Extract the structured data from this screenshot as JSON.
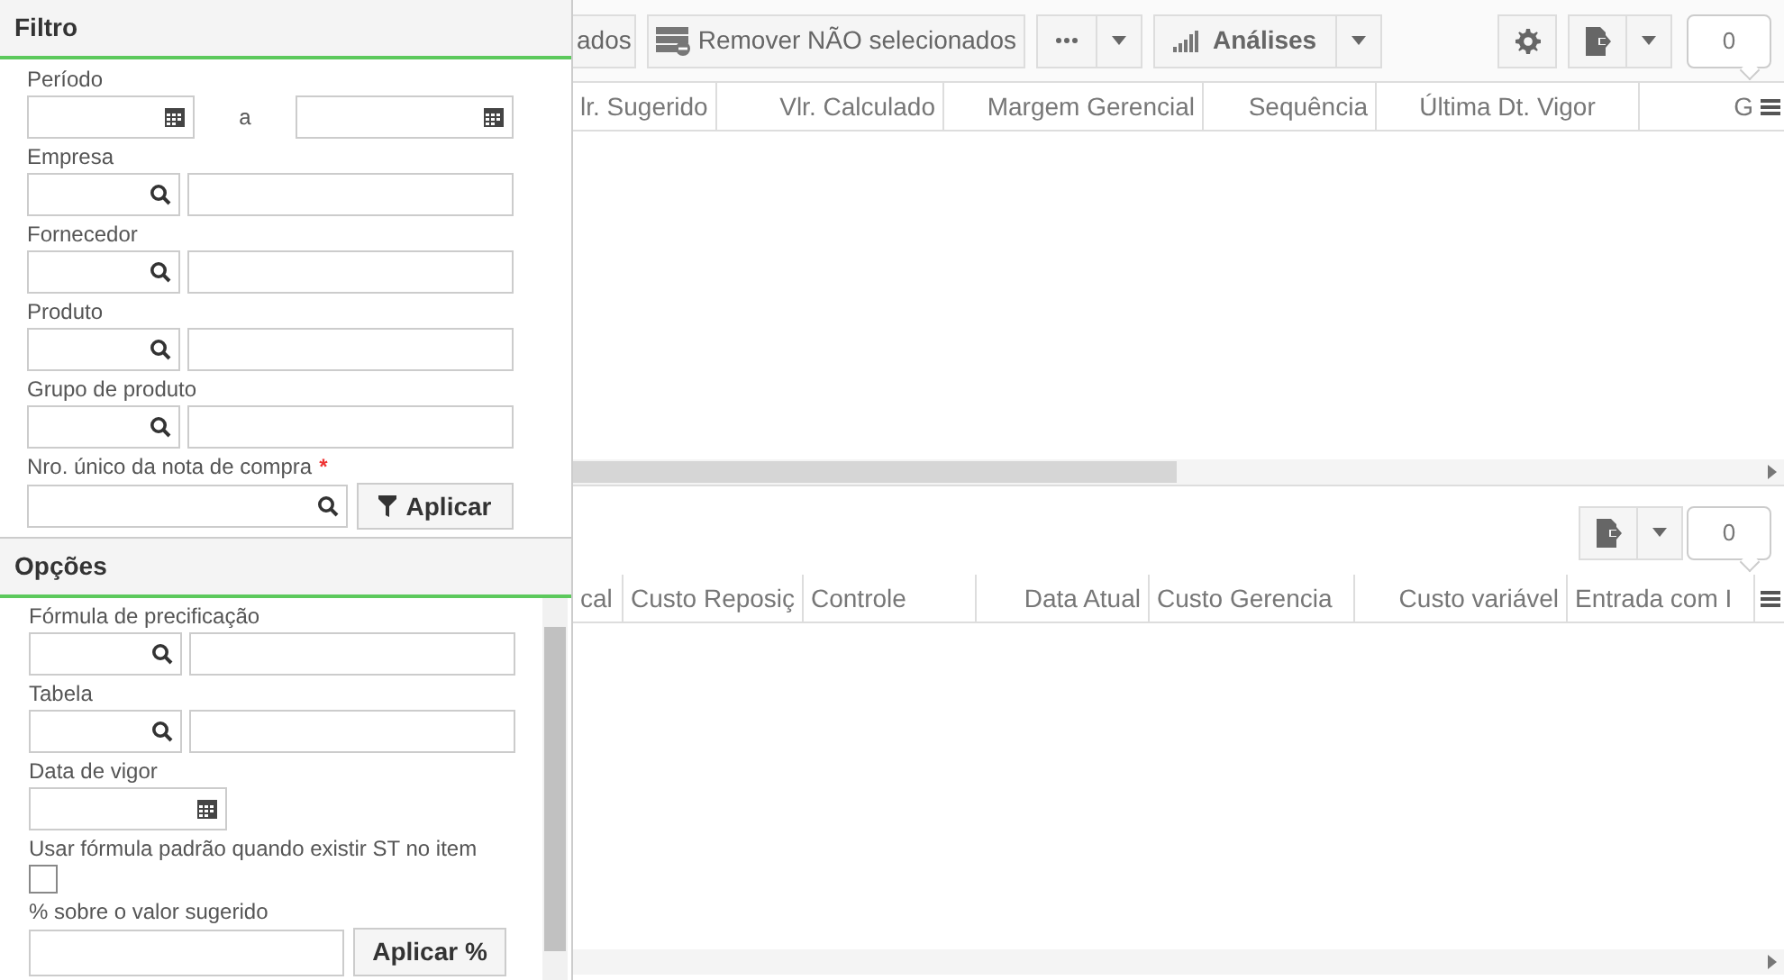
{
  "filter": {
    "title": "Filtro",
    "fields": [
      {
        "kind": "date_range",
        "label": "Período",
        "separator": "a"
      },
      {
        "kind": "lookup",
        "label": "Empresa"
      },
      {
        "kind": "lookup",
        "label": "Fornecedor"
      },
      {
        "kind": "lookup",
        "label": "Produto"
      },
      {
        "kind": "lookup",
        "label": "Grupo de produto"
      },
      {
        "kind": "search_apply",
        "label": "Nro. único da nota de compra",
        "required_mark": "*",
        "button": "Aplicar"
      }
    ]
  },
  "options": {
    "title": "Opções",
    "fields": [
      {
        "kind": "lookup",
        "label": "Fórmula de precificação"
      },
      {
        "kind": "lookup",
        "label": "Tabela"
      },
      {
        "kind": "date",
        "label": "Data de vigor"
      },
      {
        "kind": "checkbox",
        "label": "Usar fórmula padrão quando existir ST no item",
        "checked": false
      },
      {
        "kind": "input_button",
        "label": "% sobre o valor sugerido",
        "button": "Aplicar %"
      }
    ]
  },
  "toolbar": {
    "items": [
      {
        "kind": "text",
        "label": "ados"
      },
      {
        "kind": "remove",
        "label": "Remover NÃO selecionados"
      },
      {
        "kind": "more_split"
      },
      {
        "kind": "chart_split",
        "label": "Análises"
      }
    ],
    "counter": "0"
  },
  "top_grid": {
    "columns": [
      "lr. Sugerido",
      "Vlr. Calculado",
      "Margem Gerencial",
      "Sequência",
      "Última Dt. Vigor",
      "G"
    ]
  },
  "bottom_grid": {
    "counter": "0",
    "columns": [
      "cal",
      "Custo Reposiç",
      "Controle",
      "Data Atual",
      "Custo Gerencia",
      "Custo variável",
      "Entrada com I"
    ]
  }
}
